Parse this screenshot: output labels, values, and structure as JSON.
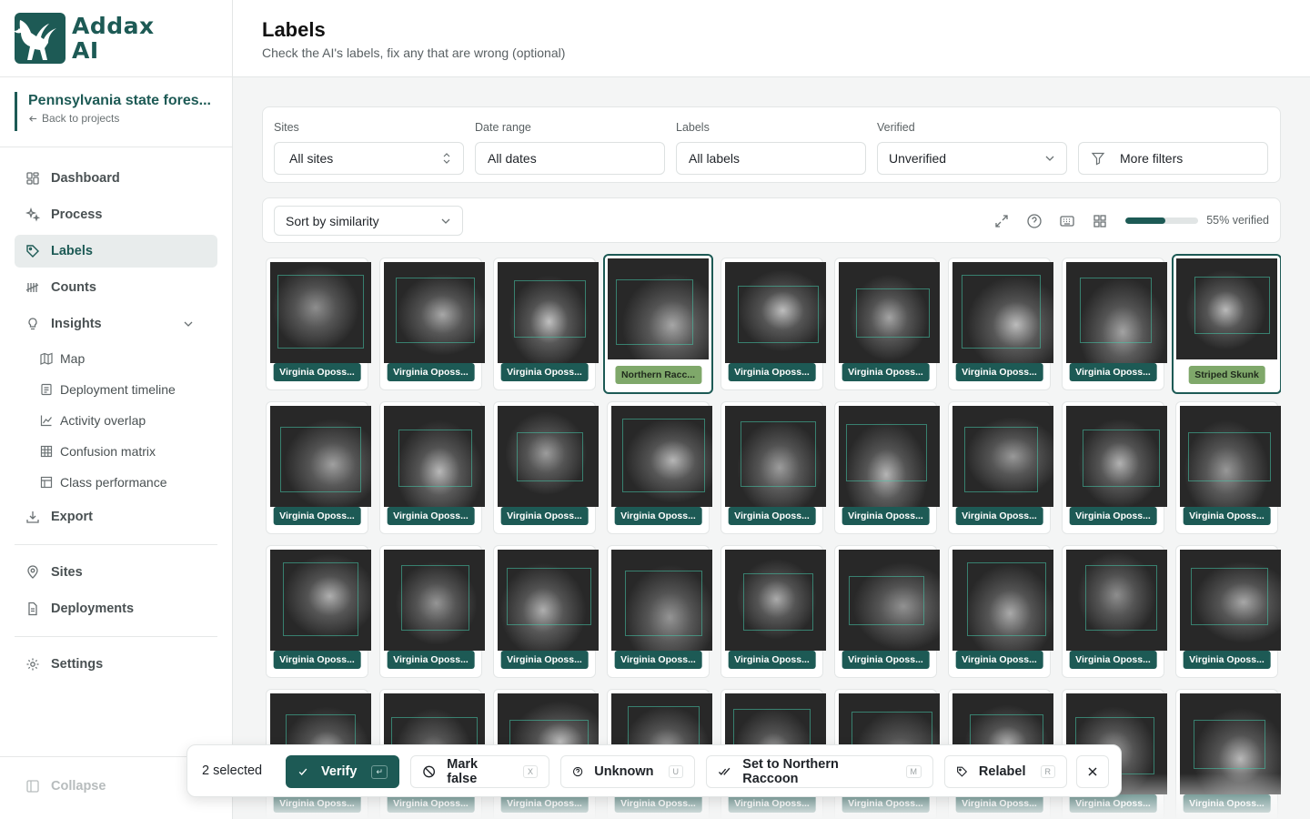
{
  "brand": {
    "line1": "Addax",
    "line2": "AI",
    "color": "#1d5a55"
  },
  "project": {
    "name": "Pennsylvania state fores...",
    "back": "Back to projects"
  },
  "nav": {
    "dashboard": "Dashboard",
    "process": "Process",
    "labels": "Labels",
    "counts": "Counts",
    "insights": "Insights",
    "map": "Map",
    "deployment_timeline": "Deployment timeline",
    "activity_overlap": "Activity overlap",
    "confusion_matrix": "Confusion matrix",
    "class_performance": "Class performance",
    "export": "Export",
    "sites": "Sites",
    "deployments": "Deployments",
    "settings": "Settings",
    "collapse": "Collapse"
  },
  "header": {
    "title": "Labels",
    "subtitle": "Check the AI's labels, fix any that are wrong (optional)"
  },
  "filters": {
    "sites": {
      "label": "Sites",
      "value": "All sites"
    },
    "date": {
      "label": "Date range",
      "value": "All dates"
    },
    "labels": {
      "label": "Labels",
      "value": "All labels"
    },
    "verified": {
      "label": "Verified",
      "value": "Unverified"
    },
    "more": "More filters"
  },
  "toolbar": {
    "sort": "Sort by similarity",
    "progress_fraction": 0.55,
    "progress_text": "55% verified",
    "icons": [
      "expand-icon",
      "help-icon",
      "keyboard-icon",
      "grid-icon"
    ]
  },
  "grid": {
    "cards": [
      "Virginia Oposs...",
      "Virginia Oposs...",
      "Virginia Oposs...",
      "Northern Racc...",
      "Virginia Oposs...",
      "Virginia Oposs...",
      "Virginia Oposs...",
      "Virginia Oposs...",
      "Striped Skunk",
      "Virginia Oposs...",
      "Virginia Oposs...",
      "Virginia Oposs...",
      "Virginia Oposs...",
      "Virginia Oposs...",
      "Virginia Oposs...",
      "Virginia Oposs...",
      "Virginia Oposs...",
      "Virginia Oposs...",
      "Virginia Oposs...",
      "Virginia Oposs...",
      "Virginia Oposs...",
      "Virginia Oposs...",
      "Virginia Oposs...",
      "Virginia Oposs...",
      "Virginia Oposs...",
      "Virginia Oposs...",
      "Virginia Oposs...",
      "Virginia Oposs...",
      "Virginia Oposs...",
      "Virginia Oposs...",
      "Virginia Oposs...",
      "Virginia Oposs...",
      "Virginia Oposs...",
      "Virginia Oposs...",
      "Virginia Oposs...",
      "Virginia Oposs..."
    ],
    "selected_indices": [
      3,
      8
    ],
    "alt_label_indices": [
      3,
      8
    ]
  },
  "actions": {
    "count": "2 selected",
    "verify": "Verify",
    "verify_key": "↵",
    "mark_false": "Mark false",
    "mark_false_key": "X",
    "unknown": "Unknown",
    "unknown_key": "U",
    "set_to": "Set to Northern Raccoon",
    "set_to_key": "M",
    "relabel": "Relabel",
    "relabel_key": "R"
  }
}
